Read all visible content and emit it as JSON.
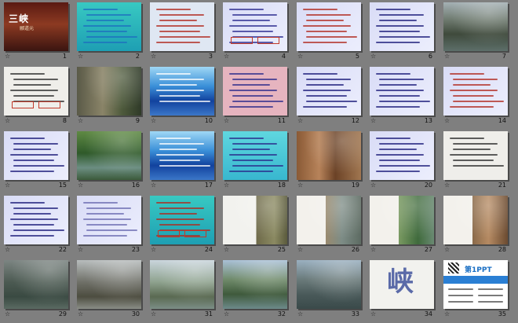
{
  "window": {
    "title": "",
    "view": "slide-sorter"
  },
  "colors": {
    "background": "#7f7f7f",
    "shadow": "#4a4a4a",
    "slide_number": "#111111"
  },
  "star_glyph": "☆",
  "slides": [
    {
      "number": "1",
      "style": "title",
      "title": "三峡",
      "subtitle": "郦道元"
    },
    {
      "number": "2",
      "style": "teal",
      "line_color": "#1e6fbf"
    },
    {
      "number": "3",
      "style": "lightblue",
      "line_color": "#b0281e"
    },
    {
      "number": "4",
      "style": "lavender",
      "line_color": "#2b2b8f",
      "boxes": true
    },
    {
      "number": "5",
      "style": "lavender",
      "line_color": "#b0281e"
    },
    {
      "number": "6",
      "style": "lavender",
      "line_color": "#1b1b7a"
    },
    {
      "number": "7",
      "style": "photo-gorge"
    },
    {
      "number": "8",
      "style": "paper",
      "line_color": "#2b2b2b",
      "boxes": true
    },
    {
      "number": "9",
      "style": "photo-cliff"
    },
    {
      "number": "10",
      "style": "bluegrad",
      "line_color": "#ffffff"
    },
    {
      "number": "11",
      "style": "pink",
      "line_color": "#2a2a8a"
    },
    {
      "number": "12",
      "style": "lavender",
      "line_color": "#1b1b7a"
    },
    {
      "number": "13",
      "style": "lavender",
      "line_color": "#1b1b7a"
    },
    {
      "number": "14",
      "style": "lavender",
      "line_color": "#b0281e"
    },
    {
      "number": "15",
      "style": "lavender",
      "line_color": "#1b1b7a"
    },
    {
      "number": "16",
      "style": "photo-green"
    },
    {
      "number": "17",
      "style": "bluegrad",
      "line_color": "#ffffff"
    },
    {
      "number": "18",
      "style": "cyan",
      "line_color": "#2a2a8a"
    },
    {
      "number": "19",
      "style": "photo-rock"
    },
    {
      "number": "20",
      "style": "lavender",
      "line_color": "#1b1b7a"
    },
    {
      "number": "21",
      "style": "paper",
      "line_color": "#2b2b2b"
    },
    {
      "number": "22",
      "style": "lavender",
      "line_color": "#1b1b7a"
    },
    {
      "number": "23",
      "style": "lavender",
      "line_color": "#6a6ab0"
    },
    {
      "number": "24",
      "style": "teal",
      "line_color": "#b0281e",
      "boxes": true
    },
    {
      "number": "25",
      "style": "photo-split"
    },
    {
      "number": "26",
      "style": "photo-water"
    },
    {
      "number": "27",
      "style": "photo-split2"
    },
    {
      "number": "28",
      "style": "photo-split3"
    },
    {
      "number": "29",
      "style": "photo-mist"
    },
    {
      "number": "30",
      "style": "photo-gorge2"
    },
    {
      "number": "31",
      "style": "photo-sky"
    },
    {
      "number": "32",
      "style": "photo-hills"
    },
    {
      "number": "33",
      "style": "photo-boat"
    },
    {
      "number": "34",
      "style": "ink",
      "glyph": "峡"
    },
    {
      "number": "35",
      "style": "promo",
      "logo": "第1PPT"
    }
  ]
}
